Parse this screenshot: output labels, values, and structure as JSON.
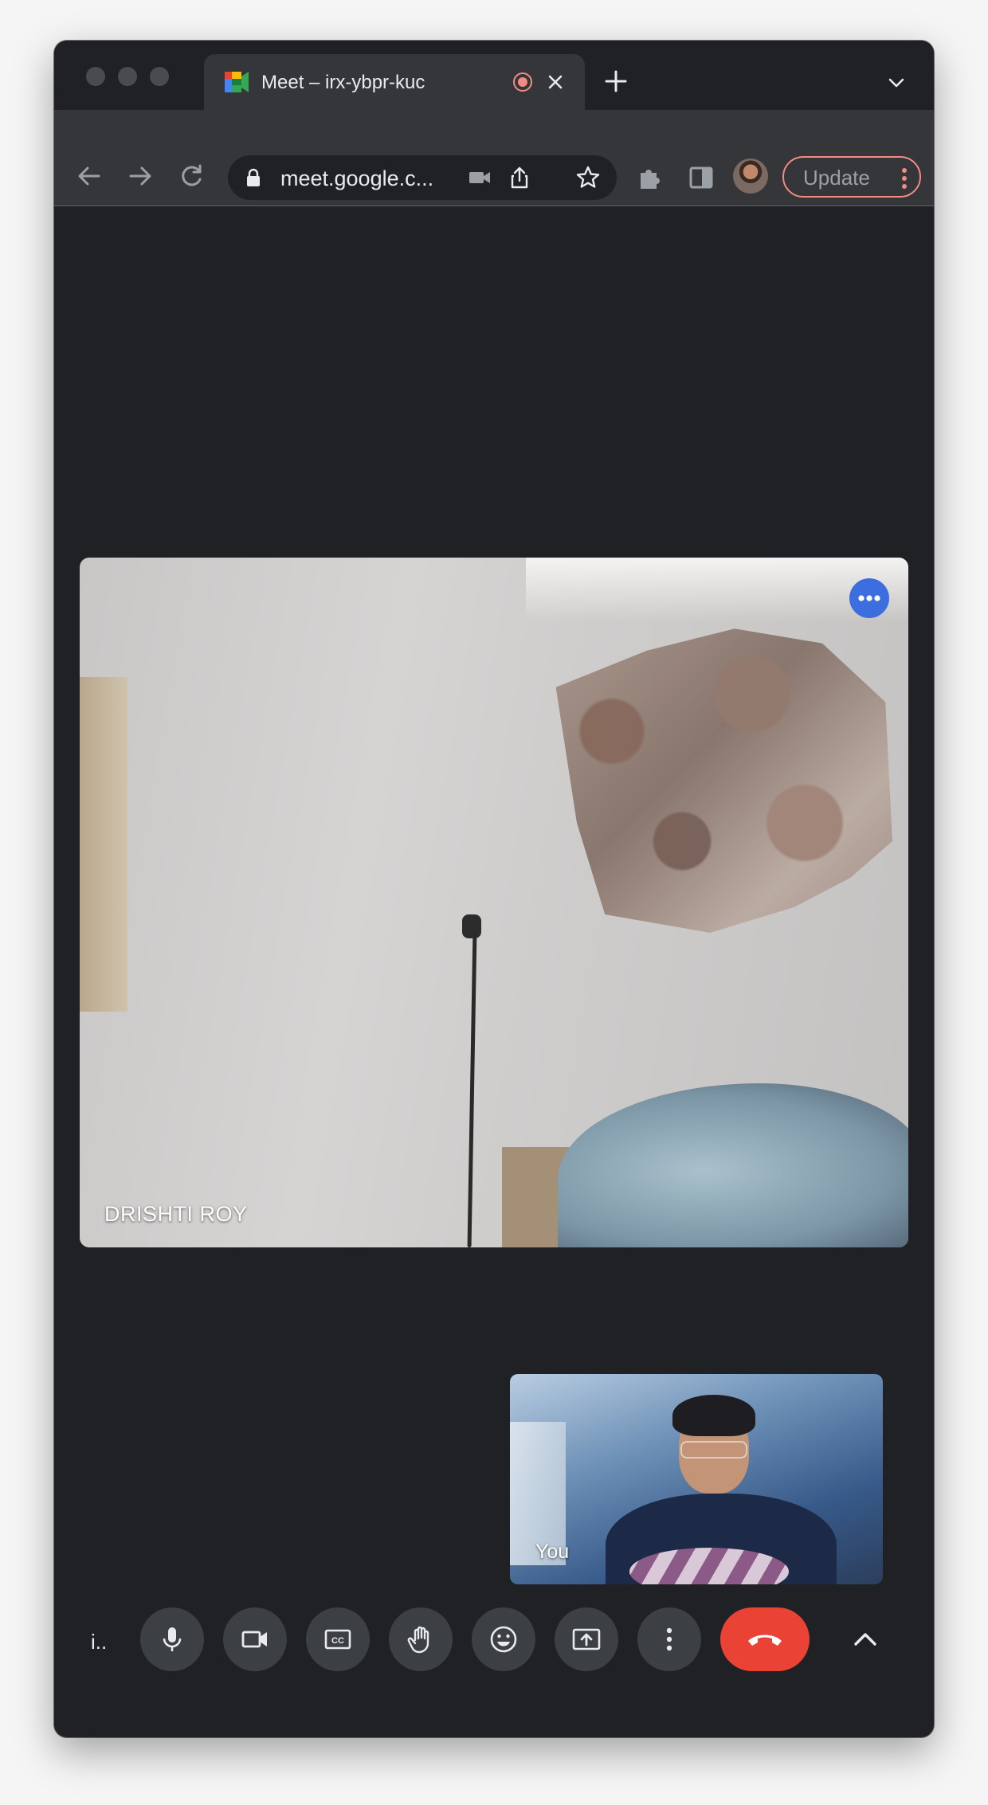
{
  "browser": {
    "tab": {
      "title": "Meet – irx-ybpr-kuc"
    },
    "omnibox": {
      "url": "meet.google.c..."
    },
    "update_button": {
      "label": "Update"
    }
  },
  "meeting": {
    "main_participant": {
      "name": "DRISHTI ROY"
    },
    "self_view": {
      "label": "You"
    },
    "controls": {
      "meeting_code_short": "i..",
      "items": [
        {
          "name": "microphone",
          "icon": "mic-icon"
        },
        {
          "name": "camera",
          "icon": "videocam-icon"
        },
        {
          "name": "captions",
          "icon": "closed-caption-icon"
        },
        {
          "name": "raise-hand",
          "icon": "hand-icon"
        },
        {
          "name": "reactions",
          "icon": "emoji-icon"
        },
        {
          "name": "present",
          "icon": "present-screen-icon"
        },
        {
          "name": "more-options",
          "icon": "more-vert-icon"
        },
        {
          "name": "leave-call",
          "icon": "call-end-icon"
        }
      ]
    }
  },
  "colors": {
    "background": "#202124",
    "toolbar": "#35363a",
    "control_button": "#3c4043",
    "end_call": "#ea4335",
    "accent_blue": "#3d6ee0",
    "recording": "#f28b82"
  }
}
